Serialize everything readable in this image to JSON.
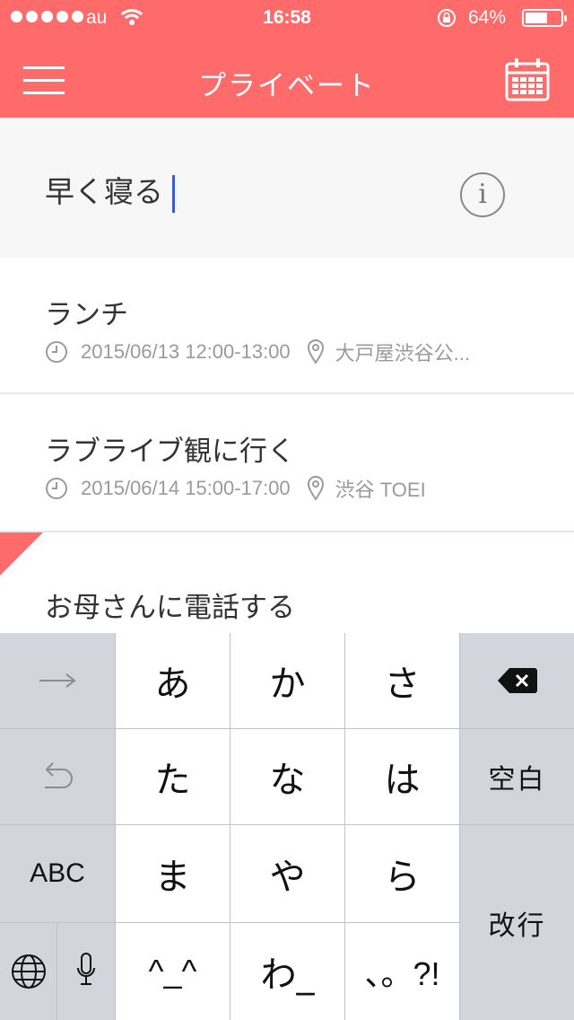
{
  "status_bar": {
    "carrier": "au",
    "time": "16:58",
    "battery": "64%",
    "battery_level": 0.64
  },
  "header": {
    "title": "プライベート",
    "menu_icon": "hamburger-menu-icon",
    "calendar_icon": "calendar-icon",
    "color": "#ff6b6b"
  },
  "new_task": {
    "value": "早く寝る",
    "info_icon": "i"
  },
  "tasks": [
    {
      "title": "ランチ",
      "datetime": "2015/06/13 12:00-13:00",
      "location": "大戸屋渋谷公..."
    },
    {
      "title": "ラブライブ観に行く",
      "datetime": "2015/06/14 15:00-17:00",
      "location": "渋谷 TOEI"
    },
    {
      "title": "お母さんに電話する"
    }
  ],
  "keyboard": {
    "keys": {
      "a": "あ",
      "ka": "か",
      "sa": "さ",
      "ta": "た",
      "na": "な",
      "ha": "は",
      "ma": "ま",
      "ya": "や",
      "ra": "ら",
      "emoji": "^_^",
      "wa": "わ_",
      "punct": "、。?!",
      "space": "空白",
      "return": "改行",
      "abc": "ABC"
    }
  }
}
